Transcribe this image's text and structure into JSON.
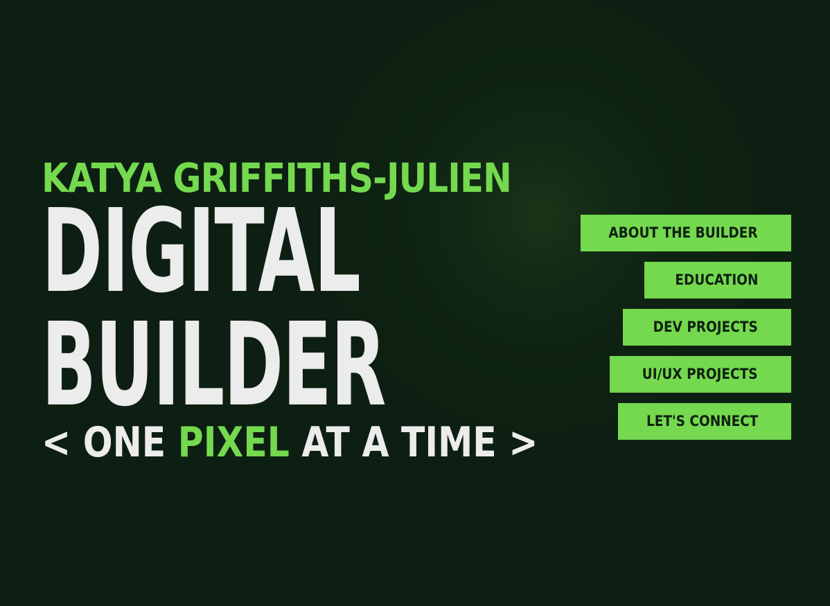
{
  "hero": {
    "name": "KATYA GRIFFITHS-JULIEN",
    "headline_line1": "DIGITAL",
    "headline_line2": "BUILDER",
    "tagline_prefix": "< ONE ",
    "tagline_accent": "PIXEL",
    "tagline_suffix": " AT A TIME >"
  },
  "nav": {
    "items": [
      {
        "label": "ABOUT THE BUILDER"
      },
      {
        "label": "EDUCATION"
      },
      {
        "label": "DEV PROJECTS"
      },
      {
        "label": "UI/UX PROJECTS"
      },
      {
        "label": "LET'S CONNECT"
      }
    ]
  },
  "colors": {
    "background": "#0d1f12",
    "accent": "#74d94e",
    "headline_text": "#ececec",
    "button_text": "#0f2012"
  }
}
